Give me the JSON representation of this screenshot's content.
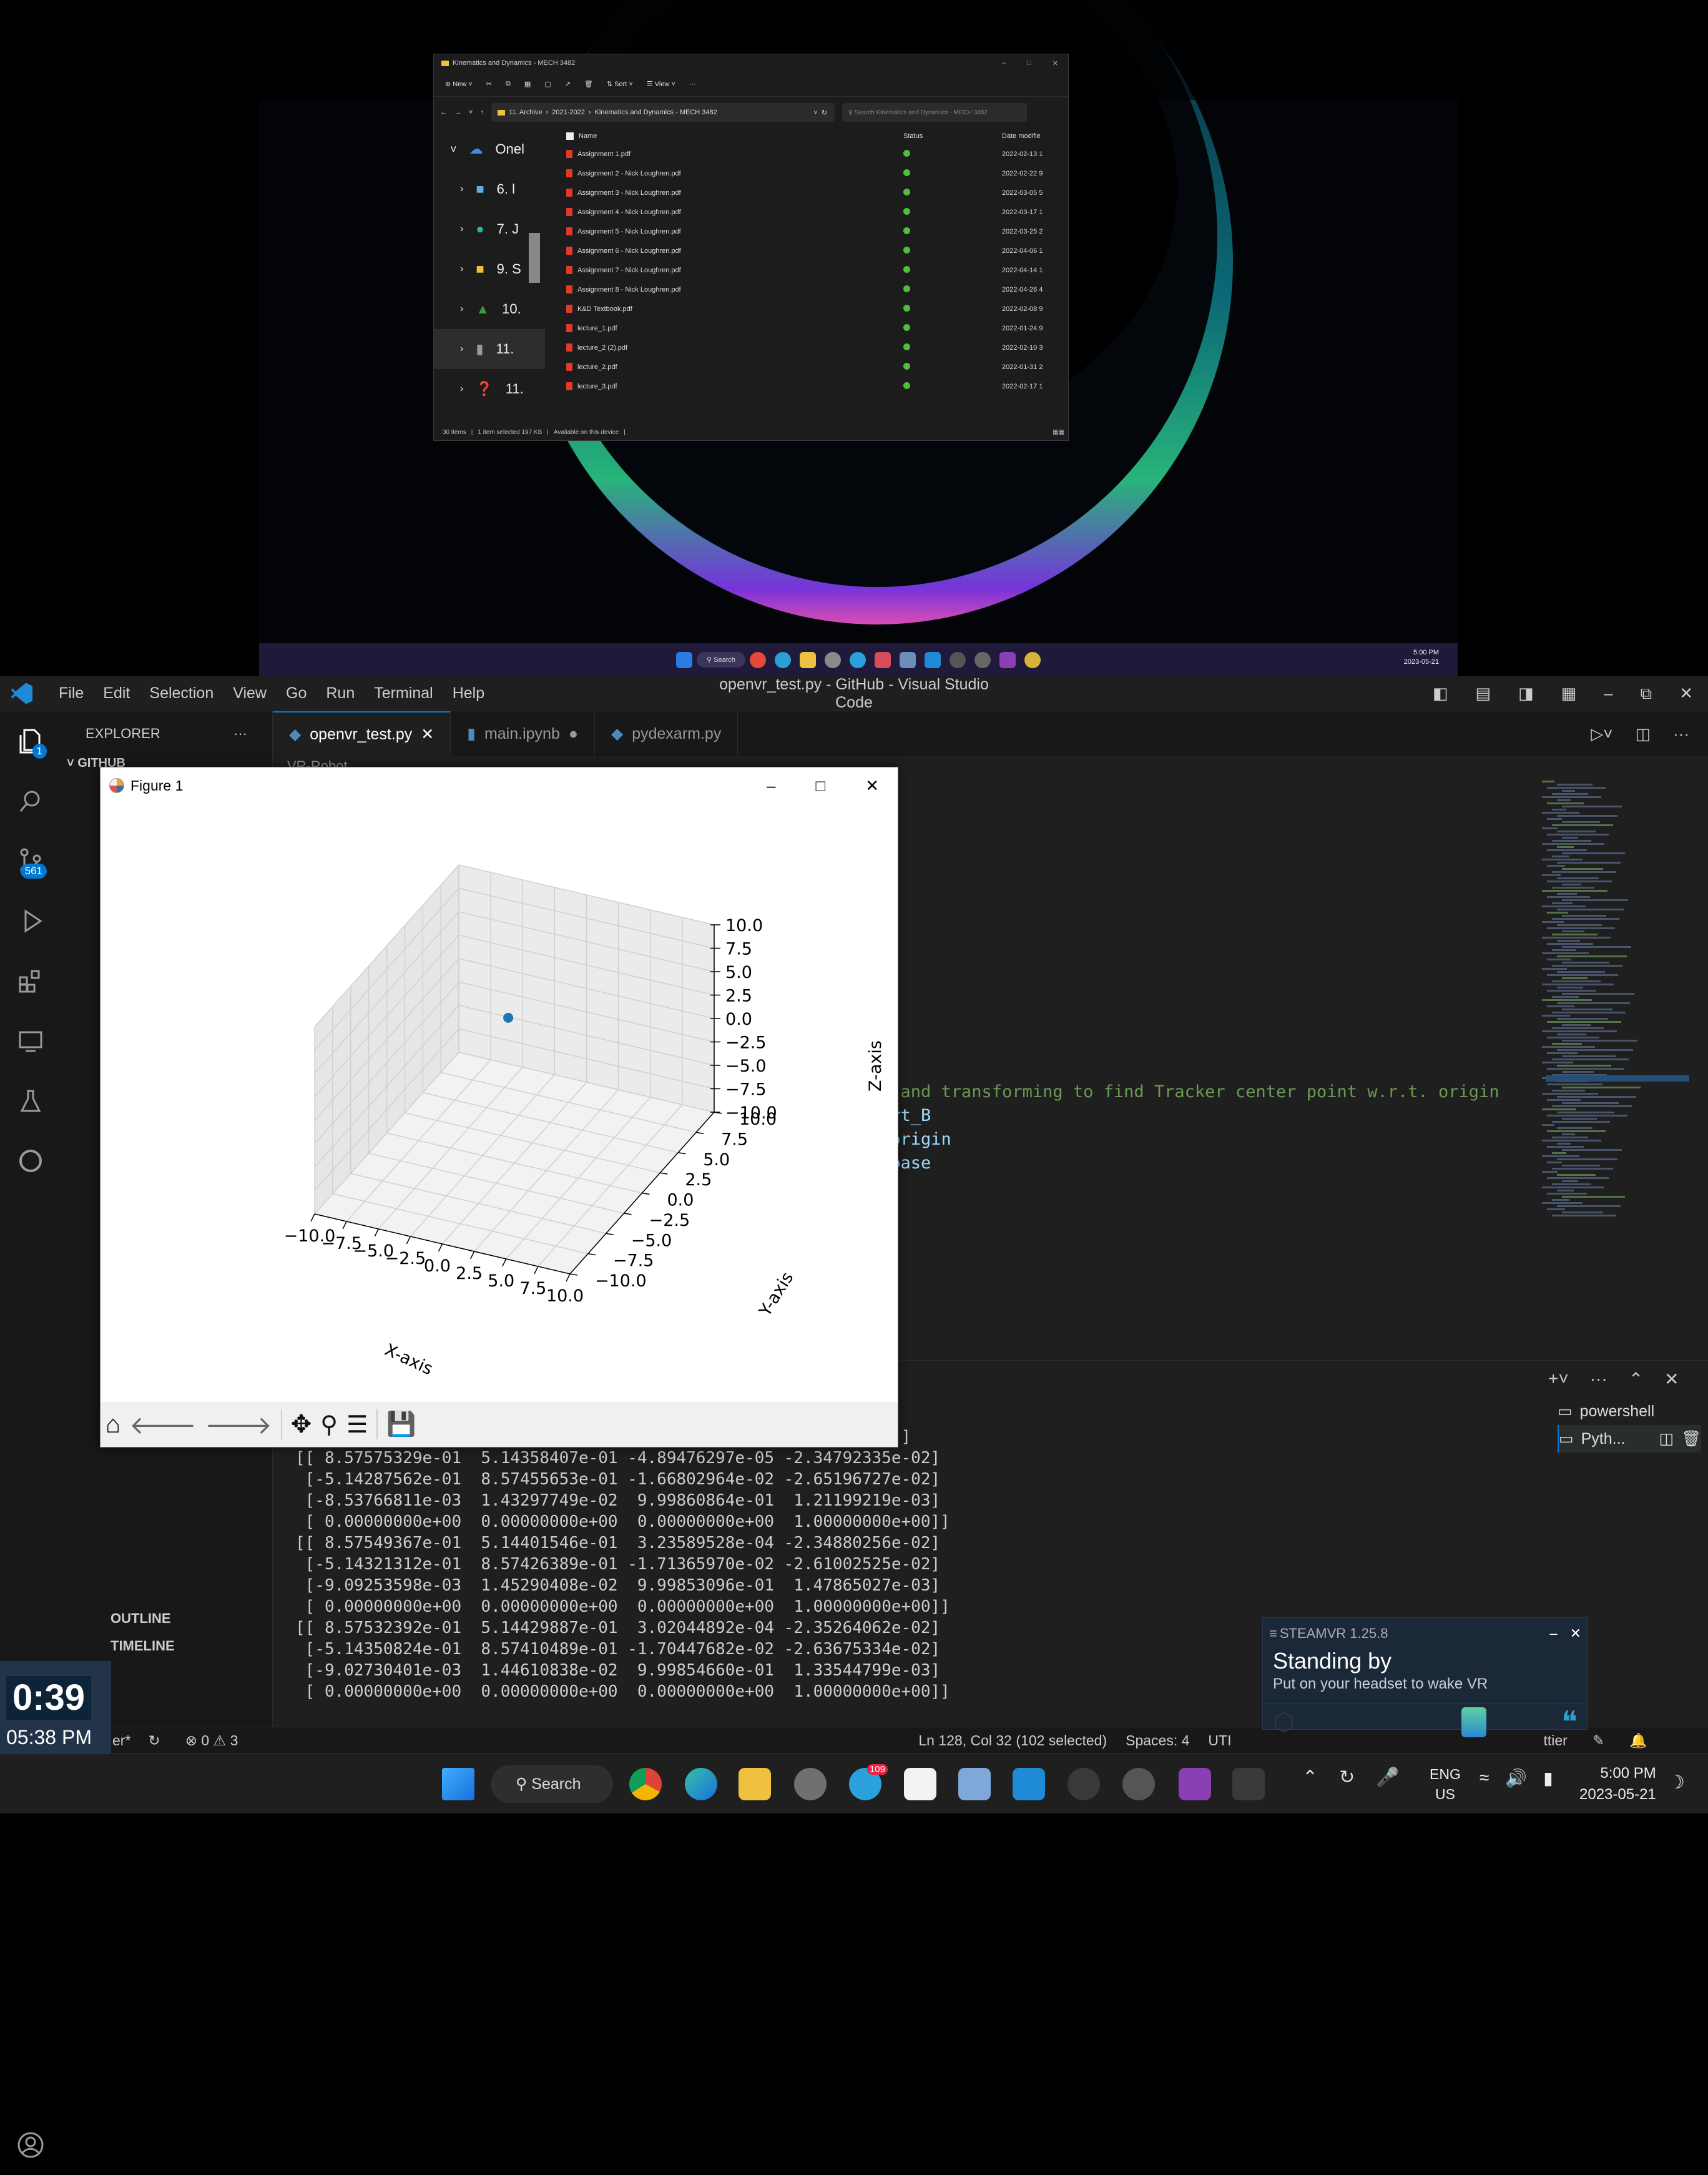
{
  "explorer": {
    "title": "Kinematics and Dynamics - MECH 3482",
    "toolbar": {
      "new": "New",
      "sort": "Sort",
      "view": "View",
      "more": "···"
    },
    "breadcrumb": [
      "11. Archive",
      "2021-2022",
      "Kinematics and Dynamics - MECH 3482"
    ],
    "search_placeholder": "Search Kinematics and Dynamics - MECH 3482",
    "columns": {
      "name": "Name",
      "status": "Status",
      "date": "Date modifie"
    },
    "nav": [
      {
        "label": "Onel"
      },
      {
        "label": "6. l"
      },
      {
        "label": "7. J"
      },
      {
        "label": "9. S"
      },
      {
        "label": "10."
      },
      {
        "label": "11."
      },
      {
        "label": "11."
      }
    ],
    "files": [
      {
        "name": "Assignment 1.pdf",
        "date": "2022-02-13 1"
      },
      {
        "name": "Assignment 2 - Nick Loughren.pdf",
        "date": "2022-02-22 9"
      },
      {
        "name": "Assignment 3 - Nick Loughren.pdf",
        "date": "2022-03-05 5"
      },
      {
        "name": "Assignment 4 - Nick Loughren.pdf",
        "date": "2022-03-17 1"
      },
      {
        "name": "Assignment 5 - Nick Loughren.pdf",
        "date": "2022-03-25 2"
      },
      {
        "name": "Assignment 6 - Nick Loughren.pdf",
        "date": "2022-04-06 1"
      },
      {
        "name": "Assignment 7 - Nick Loughren.pdf",
        "date": "2022-04-14 1"
      },
      {
        "name": "Assignment 8 - Nick Loughren.pdf",
        "date": "2022-04-26 4"
      },
      {
        "name": "K&D Textbook.pdf",
        "date": "2022-02-08 9"
      },
      {
        "name": "lecture_1.pdf",
        "date": "2022-01-24 9"
      },
      {
        "name": "lecture_2 (2).pdf",
        "date": "2022-02-10 3"
      },
      {
        "name": "lecture_2.pdf",
        "date": "2022-01-31 2"
      },
      {
        "name": "lecture_3.pdf",
        "date": "2022-02-17 1"
      }
    ],
    "status": {
      "items": "30 items",
      "selected": "1 item selected  197 KB",
      "availability": "Available on this device"
    }
  },
  "mini_taskbar": {
    "search": "Search",
    "time": "5:00 PM",
    "date": "2023-05-21"
  },
  "vscode": {
    "menu": [
      "File",
      "Edit",
      "Selection",
      "View",
      "Go",
      "Run",
      "Terminal",
      "Help"
    ],
    "title": "openvr_test.py - GitHub - Visual Studio Code",
    "explorer_label": "EXPLORER",
    "explorer_section": "GITHUB",
    "outline": "OUTLINE",
    "timeline": "TIMELINE",
    "tabs": [
      {
        "label": "openvr_test.py",
        "state": "active"
      },
      {
        "label": "main.ipynb",
        "state": "modified"
      },
      {
        "label": "pydexarm.py",
        "state": ""
      }
    ],
    "breadcrumb_partial": "VR-Robot",
    "badges": {
      "explorer": "1",
      "source_control": "561"
    },
    "code_lines": [
      {
        "text": "n and transforming to find Tracker center point w.r.t. origin",
        "color": "#6a9955"
      },
      {
        "text": "wrt_B",
        "color": "#9cdcfe"
      },
      {
        "text": "_origin",
        "color": "#9cdcfe"
      },
      {
        "text": "_base",
        "color": "#9cdcfe"
      }
    ],
    "terminal_lines": [
      "                                                            3]",
      "                                                            0]]",
      "[[ 8.57575329e-01  5.14358407e-01 -4.89476297e-05 -2.34792335e-02]",
      " [-5.14287562e-01  8.57455653e-01 -1.66802964e-02 -2.65196727e-02]",
      " [-8.53766811e-03  1.43297749e-02  9.99860864e-01  1.21199219e-03]",
      " [ 0.00000000e+00  0.00000000e+00  0.00000000e+00  1.00000000e+00]]",
      "[[ 8.57549367e-01  5.14401546e-01  3.23589528e-04 -2.34880256e-02]",
      " [-5.14321312e-01  8.57426389e-01 -1.71365970e-02 -2.61002525e-02]",
      " [-9.09253598e-03  1.45290408e-02  9.99853096e-01  1.47865027e-03]",
      " [ 0.00000000e+00  0.00000000e+00  0.00000000e+00  1.00000000e+00]]",
      "[[ 8.57532392e-01  5.14429887e-01  3.02044892e-04 -2.35264062e-02]",
      " [-5.14350824e-01  8.57410489e-01 -1.70447682e-02 -2.63675334e-02]",
      " [-9.02730401e-03  1.44610838e-02  9.99854660e-01  1.33544799e-03]",
      " [ 0.00000000e+00  0.00000000e+00  0.00000000e+00  1.00000000e+00]]"
    ],
    "terminals": [
      "powershell",
      "Pyth..."
    ],
    "status": {
      "branch": "er*",
      "errors": "0",
      "warnings": "3",
      "position": "Ln 128, Col 32 (102 selected)",
      "spaces": "Spaces: 4",
      "encoding": "UTI",
      "prettier": "ttier"
    }
  },
  "figure": {
    "title": "Figure 1",
    "xlabel": "X-axis",
    "ylabel": "Y-axis",
    "zlabel": "Z-axis",
    "ticks": [
      "−10.0",
      "−7.5",
      "−5.0",
      "−2.5",
      "0.0",
      "2.5",
      "5.0",
      "7.5",
      "10.0"
    ],
    "z_ticks": [
      "10.0",
      "7.5",
      "5.0",
      "2.5",
      "0.0",
      "−2.5",
      "−5.0",
      "−7.5",
      "−10.0"
    ],
    "y_ticks": [
      "10.0",
      "7.5",
      "5.0",
      "2.5",
      "0.0",
      "−2.5",
      "−5.0",
      "−7.5",
      "−10.0"
    ],
    "x_ticks": [
      "−10.0",
      "−7.5",
      "−5.0",
      "−2.5",
      "0.0",
      "2.5",
      "5.0",
      "7.5",
      "10.0"
    ],
    "point_color": "#1f77b4"
  },
  "chart_data": {
    "type": "scatter",
    "title": "",
    "xlabel": "X-axis",
    "ylabel": "Y-axis",
    "zlabel": "Z-axis",
    "xlim": [
      -10,
      10
    ],
    "ylim": [
      -10,
      10
    ],
    "zlim": [
      -10,
      10
    ],
    "grid": true,
    "series": [
      {
        "x": [
          -5
        ],
        "y": [
          8
        ],
        "z": [
          -3
        ]
      }
    ]
  },
  "steamvr": {
    "header": "STEAMVR 1.25.8",
    "title": "Standing by",
    "subtitle": "Put on your headset to wake VR"
  },
  "timer": {
    "elapsed": "0:39",
    "clock": "05:38 PM"
  },
  "taskbar": {
    "search": "Search",
    "lang1": "ENG",
    "lang2": "US",
    "time": "5:00 PM",
    "date": "2023-05-21",
    "telegram_badge": "109"
  }
}
